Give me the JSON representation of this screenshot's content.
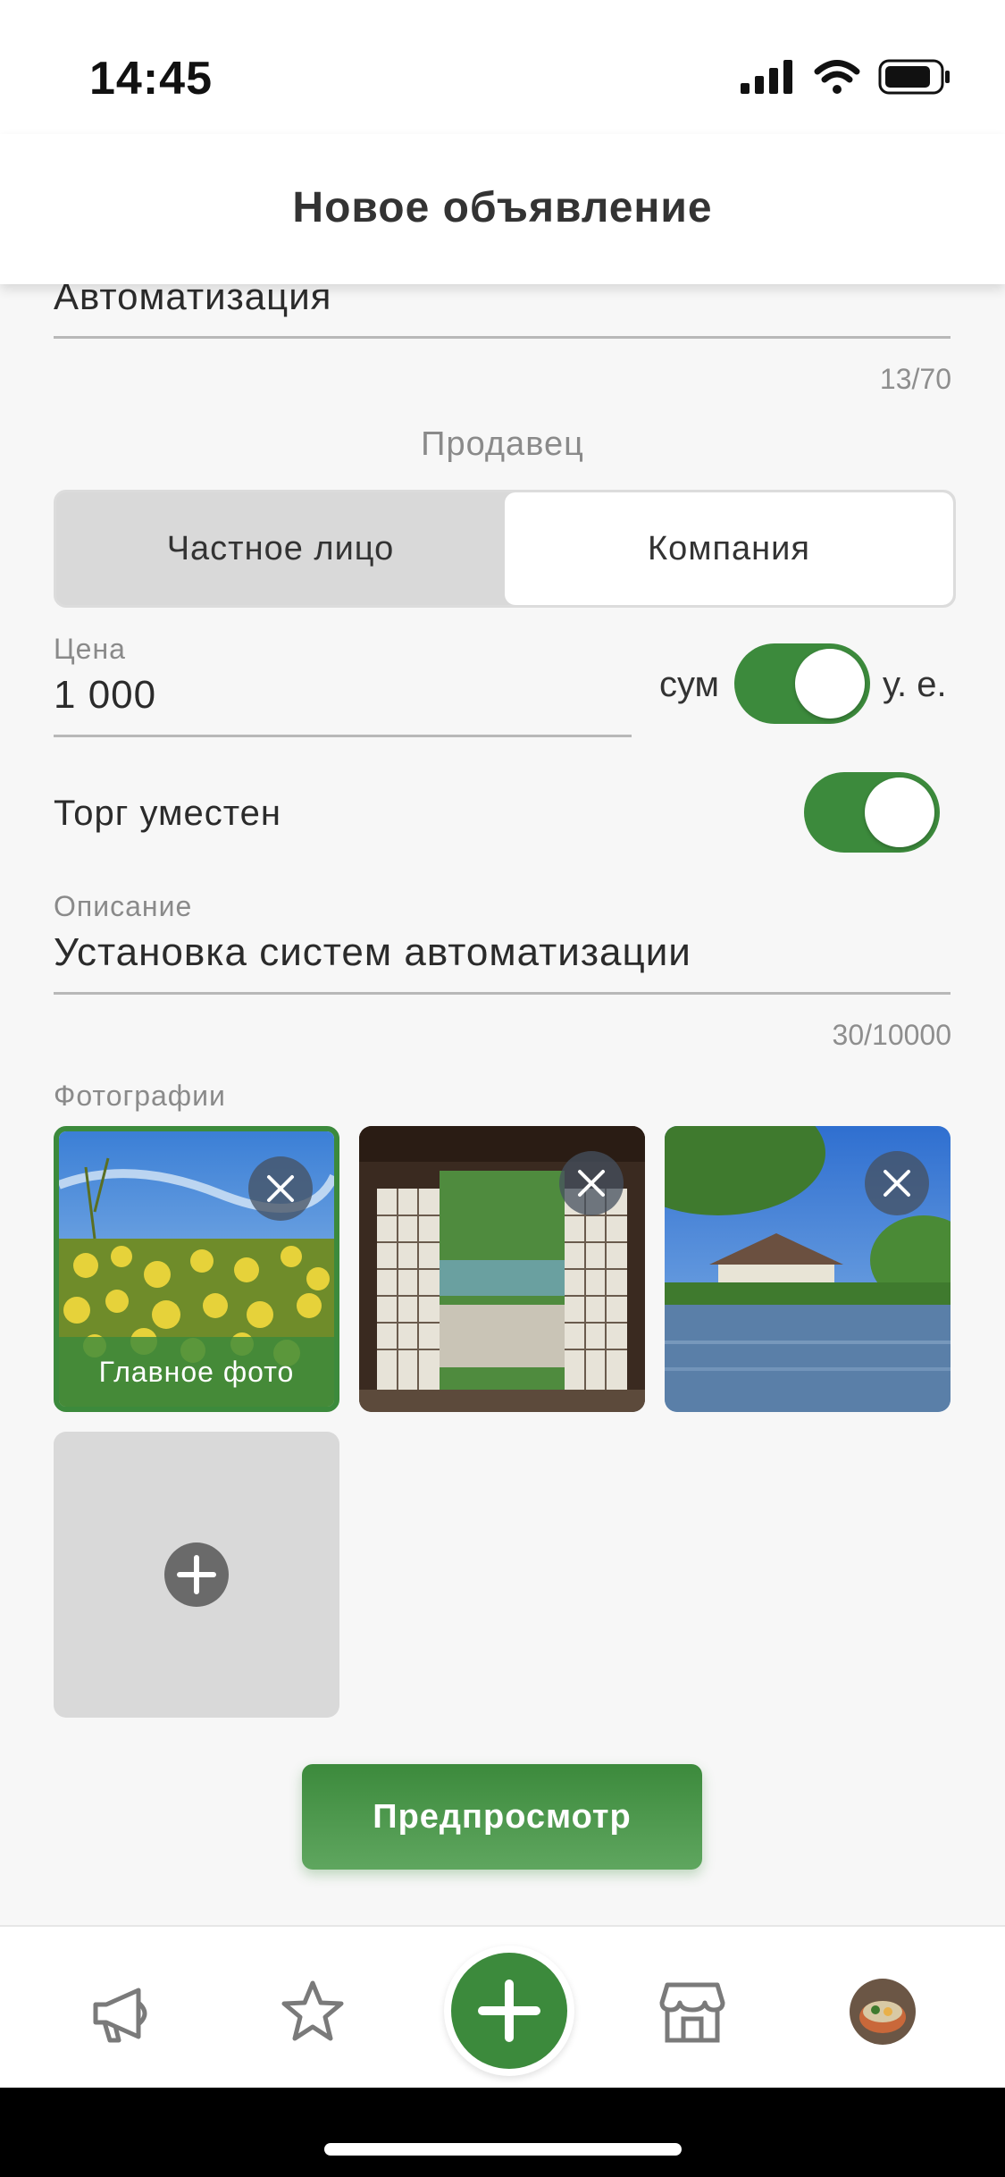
{
  "status": {
    "time": "14:45"
  },
  "header": {
    "title": "Новое объявление"
  },
  "listing": {
    "title_value": "Автоматизация",
    "title_counter": "13/70",
    "seller_label": "Продавец",
    "seller_options": [
      "Частное лицо",
      "Компания"
    ],
    "seller_selected": "Компания",
    "price_label": "Цена",
    "price_value": "1 000",
    "currency_left": "сум",
    "currency_right": "у. е.",
    "currency_toggle_on": true,
    "negotiable_label": "Торг уместен",
    "negotiable_on": true,
    "description_label": "Описание",
    "description_value": "Установка систем автоматизации",
    "description_counter": "30/10000",
    "photos_label": "Фотографии",
    "main_photo_caption": "Главное фото",
    "preview_button": "Предпросмотр"
  },
  "tabs": [
    "megaphone-icon",
    "star-icon",
    "plus-icon",
    "store-icon",
    "avatar"
  ],
  "colors": {
    "accent": "#3c8a3c",
    "background": "#f7f7f7"
  }
}
